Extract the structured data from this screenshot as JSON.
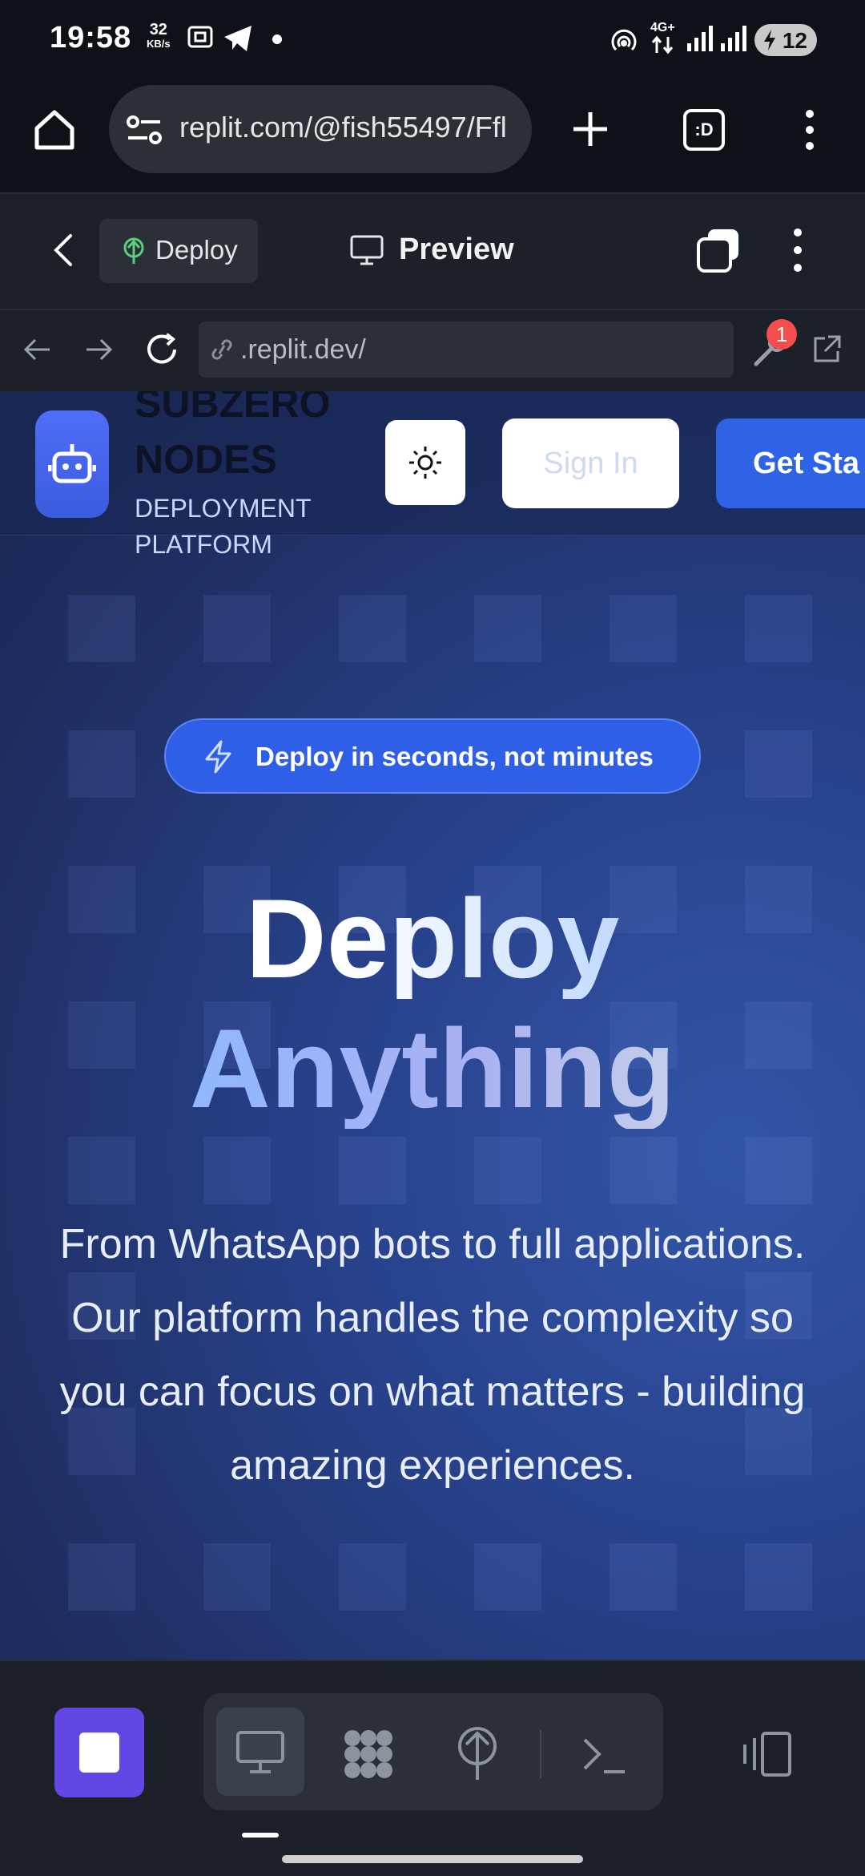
{
  "status_bar": {
    "time": "19:58",
    "net_speed_value": "32",
    "net_speed_unit": "KB/s",
    "network": "4G+",
    "battery": "12"
  },
  "browser": {
    "url": "replit.com/@fish55497/Ffl",
    "tab_count": ":D"
  },
  "replit": {
    "deploy_label": "Deploy",
    "preview_label": "Preview",
    "address": ".replit.dev/",
    "notification_count": "1"
  },
  "site": {
    "brand_top": "SUBZERO",
    "brand_name": "NODES",
    "brand_sub": "DEPLOYMENT PLATFORM",
    "sign_in": "Sign In",
    "get_started": "Get Sta",
    "tagline": "Deploy in seconds, not minutes",
    "hero_line1": "Deploy",
    "hero_line2": "Anything",
    "description": "From WhatsApp bots to full applications. Our platform handles the complexity so you can focus on what matters - building amazing experiences."
  },
  "colors": {
    "accent": "#2f63e6",
    "stop_button": "#6247e5",
    "badge": "#f34d4d"
  }
}
